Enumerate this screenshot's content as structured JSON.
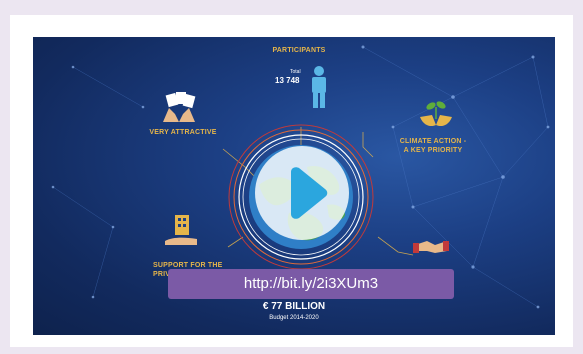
{
  "video": {
    "participants_label": "PARTICIPANTS",
    "total_caption": "Total",
    "total_value": "13 748",
    "very_attractive": "VERY ATTRACTIVE",
    "climate_action_line1": "CLIMATE ACTION -",
    "climate_action_line2": "A KEY PRIORITY",
    "support_line1": "SUPPORT FOR THE",
    "support_line2": "PRIVATE",
    "budget_amount": "€ 77 BILLION",
    "budget_period": "Budget 2014-2020",
    "link_text": "http://bit.ly/2i3XUm3"
  },
  "colors": {
    "background": "#ece6f1",
    "video_bg": "#1c3f84",
    "label_gold": "#e5b54a",
    "participant_blue": "#5bb7e6",
    "link_pill": "#7b5aa6",
    "play_arrow": "#2ba6de"
  },
  "icons": [
    "person-icon",
    "hands-papers-icon",
    "plant-hands-icon",
    "building-hand-icon",
    "handshake-icon",
    "play-icon",
    "globe-icon"
  ]
}
